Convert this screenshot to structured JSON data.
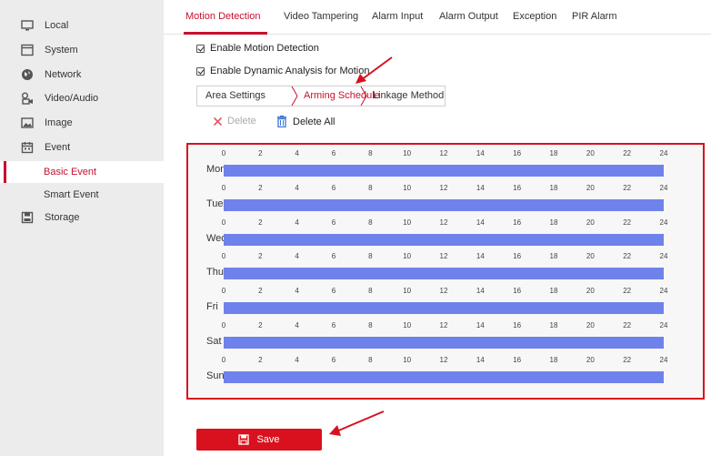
{
  "sidebar": {
    "items": [
      {
        "label": "Local",
        "icon": "monitor-icon"
      },
      {
        "label": "System",
        "icon": "system-window-icon"
      },
      {
        "label": "Network",
        "icon": "globe-icon"
      },
      {
        "label": "Video/Audio",
        "icon": "video-audio-icon"
      },
      {
        "label": "Image",
        "icon": "image-icon"
      },
      {
        "label": "Event",
        "icon": "calendar-icon"
      }
    ],
    "sub_items": [
      {
        "label": "Basic Event",
        "active": true
      },
      {
        "label": "Smart Event",
        "active": false
      }
    ],
    "storage": {
      "label": "Storage",
      "icon": "storage-icon"
    }
  },
  "tabs": [
    {
      "label": "Motion Detection",
      "active": true
    },
    {
      "label": "Video Tampering",
      "active": false
    },
    {
      "label": "Alarm Input",
      "active": false
    },
    {
      "label": "Alarm Output",
      "active": false
    },
    {
      "label": "Exception",
      "active": false
    },
    {
      "label": "PIR Alarm",
      "active": false
    }
  ],
  "options": {
    "enable_motion": {
      "label": "Enable Motion Detection",
      "checked": true
    },
    "enable_dynamic": {
      "label": "Enable Dynamic Analysis for Motion",
      "checked": true
    }
  },
  "sub_tabs": [
    {
      "label": "Area Settings",
      "active": false
    },
    {
      "label": "Arming Schedule",
      "active": true
    },
    {
      "label": "Linkage Method",
      "active": false
    }
  ],
  "toolbar": {
    "delete_label": "Delete",
    "delete_all_label": "Delete All"
  },
  "schedule": {
    "days": [
      "Mon",
      "Tue",
      "Wed",
      "Thu",
      "Fri",
      "Sat",
      "Sun"
    ],
    "hour_ticks": [
      "0",
      "2",
      "4",
      "6",
      "8",
      "10",
      "12",
      "14",
      "16",
      "18",
      "20",
      "22",
      "24"
    ],
    "segments": [
      {
        "day": "Mon",
        "start": 0,
        "end": 24
      },
      {
        "day": "Tue",
        "start": 0,
        "end": 24
      },
      {
        "day": "Wed",
        "start": 0,
        "end": 24
      },
      {
        "day": "Thu",
        "start": 0,
        "end": 24
      },
      {
        "day": "Fri",
        "start": 0,
        "end": 24
      },
      {
        "day": "Sat",
        "start": 0,
        "end": 24
      },
      {
        "day": "Sun",
        "start": 0,
        "end": 24
      }
    ]
  },
  "save_label": "Save",
  "colors": {
    "accent": "#c8102e",
    "bar": "#6f82ec",
    "highlight": "#d9101f",
    "sidebar_bg": "#ececec"
  }
}
